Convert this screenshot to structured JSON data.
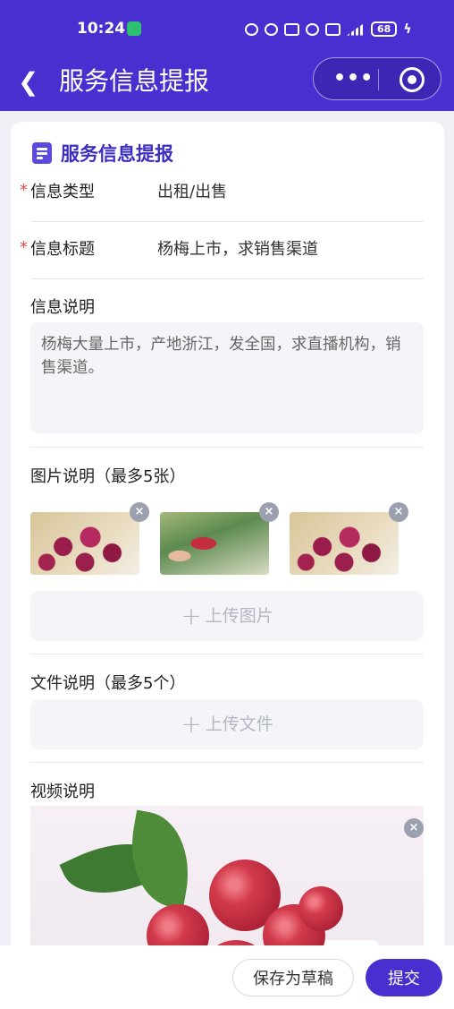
{
  "status_bar": {
    "time": "10:24",
    "battery": "68",
    "icons": [
      "alarm-icon",
      "mute-icon",
      "bluetooth-icon",
      "wifi-icon",
      "hd-icon",
      "signal-icon",
      "battery-icon",
      "charging-icon"
    ]
  },
  "navbar": {
    "title": "服务信息提报",
    "more": "•••"
  },
  "form": {
    "section_title": "服务信息提报",
    "info_type": {
      "label": "信息类型",
      "value": "出租/出售",
      "required_mark": "*"
    },
    "info_title": {
      "label": "信息标题",
      "value": "杨梅上市，求销售渠道",
      "required_mark": "*"
    },
    "description": {
      "label": "信息说明",
      "value": "杨梅大量上市，产地浙江，发全国，求直播机构，销售渠道。"
    },
    "images": {
      "label": "图片说明（最多5张）",
      "count": 3,
      "upload_label": "上传图片",
      "remove": "×"
    },
    "files": {
      "label": "文件说明（最多5个）",
      "upload_label": "上传文件"
    },
    "video": {
      "label": "视频说明",
      "remove": "×"
    }
  },
  "actions": {
    "save_draft": "保存为草稿",
    "submit": "提交"
  },
  "colors": {
    "primary": "#4a2fd0",
    "required": "#e04b4b",
    "section_title": "#3c2ec2"
  }
}
